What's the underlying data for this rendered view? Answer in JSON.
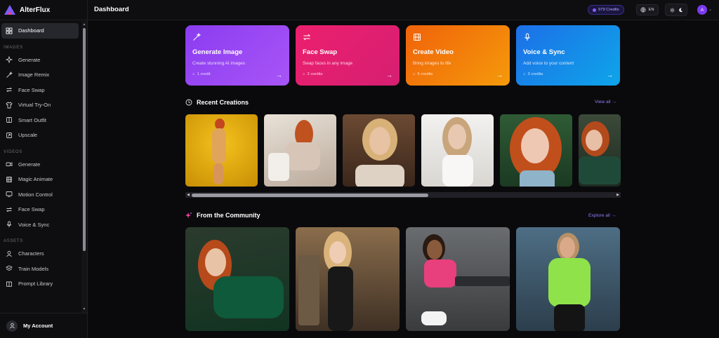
{
  "brand": {
    "name": "AlterFlux"
  },
  "header": {
    "title": "Dashboard",
    "credits": "979 Credits",
    "language": "EN",
    "avatar_initial": "A"
  },
  "sidebar": {
    "dashboard": "Dashboard",
    "sections": {
      "images": "IMAGES",
      "videos": "VIDEOS",
      "assets": "ASSETS"
    },
    "images": [
      "Generate",
      "Image Remix",
      "Face Swap",
      "Virtual Try-On",
      "Smart Outfit",
      "Upscale"
    ],
    "videos": [
      "Generate",
      "Magic Animate",
      "Motion Control",
      "Face Swap",
      "Voice & Sync"
    ],
    "assets": [
      "Characters",
      "Train Models",
      "Prompt Library"
    ],
    "account": "My Account"
  },
  "cards": [
    {
      "title": "Generate Image",
      "desc": "Create stunning AI images",
      "credits": "1 credit",
      "icon": "magic-wand-icon",
      "color_from": "#8b3cf0",
      "color_to": "#a855f7"
    },
    {
      "title": "Face Swap",
      "desc": "Swap faces in any image",
      "credits": "2 credits",
      "icon": "swap-icon",
      "color_from": "#ec1f6e",
      "color_to": "#db2777"
    },
    {
      "title": "Create Video",
      "desc": "Bring images to life",
      "credits": "5 credits",
      "icon": "film-icon",
      "color_from": "#f0620a",
      "color_to": "#f59e0b"
    },
    {
      "title": "Voice & Sync",
      "desc": "Add voice to your content",
      "credits": "3 credits",
      "icon": "microphone-icon",
      "color_from": "#1d6fe8",
      "color_to": "#0ea5e9"
    }
  ],
  "recent": {
    "title": "Recent Creations",
    "link": "View all →"
  },
  "community": {
    "title": "From the Community",
    "link": "Explore all →"
  },
  "colors": {
    "accent": "#8b5cf6",
    "link": "#8f7df5"
  }
}
